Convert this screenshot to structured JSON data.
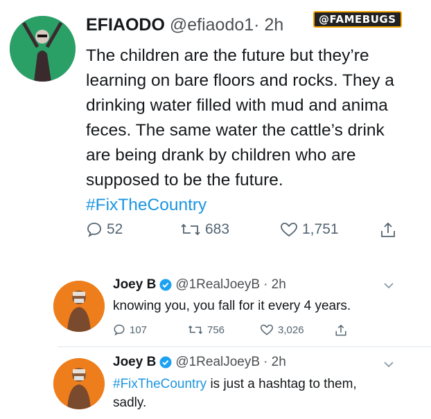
{
  "watermark": "@FAMEBUGS",
  "main_tweet": {
    "name": "EFIAODO",
    "handle": "@efiaodo1",
    "time": "· 2h",
    "body_lines": [
      "The children are the future but they’re",
      "learning on bare floors and rocks. They a",
      "drinking water filled with mud and anima",
      "feces. The same water the cattle’s drink",
      "are being drank by children who are",
      "supposed to be the future."
    ],
    "hashtag": "#FixTheCountry",
    "replies": "52",
    "retweets": "683",
    "likes": "1,751"
  },
  "replies": [
    {
      "name": "Joey B",
      "handle": "@1RealJoeyB",
      "time": "· 2h",
      "text": "knowing you, you fall for it every 4 years.",
      "replies": "107",
      "retweets": "756",
      "likes": "3,026"
    },
    {
      "name": "Joey B",
      "handle": "@1RealJoeyB",
      "time": "· 2h",
      "hashtag": "#FixTheCountry",
      "text_rest": " is just a hashtag to them,",
      "text_line2": "sadly."
    }
  ],
  "colors": {
    "link": "#1b95e0",
    "verified": "#1da1f2",
    "muted": "#536471"
  }
}
